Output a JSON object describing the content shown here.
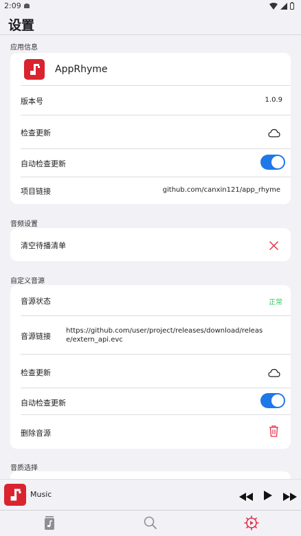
{
  "status_bar": {
    "time": "2:09"
  },
  "header": {
    "title": "设置"
  },
  "sections": {
    "app_info": {
      "title": "应用信息",
      "app_name": "AppRhyme",
      "version_label": "版本号",
      "version_value": "1.0.9",
      "check_update_label": "检查更新",
      "auto_check_label": "自动检查更新",
      "auto_check_on": true,
      "project_link_label": "项目链接",
      "project_link_value": "github.com/canxin121/app_rhyme"
    },
    "audio_settings": {
      "title": "音频设置",
      "clear_queue_label": "清空待播清单"
    },
    "custom_source": {
      "title": "自定义音源",
      "status_label": "音源状态",
      "status_value": "正常",
      "link_label": "音源链接",
      "link_value": "https://github.com/user/project/releases/download/release/extern_api.evc",
      "check_update_label": "检查更新",
      "auto_check_label": "自动检查更新",
      "auto_check_on": true,
      "delete_label": "删除音源"
    },
    "quality": {
      "title": "音质选择"
    }
  },
  "player": {
    "track_title": "Music"
  },
  "colors": {
    "accent": "#1e78e8",
    "brand_red": "#d9232f",
    "success_green": "#34c759",
    "danger_red": "#e5304a",
    "tab_active": "#e5304a"
  },
  "icons": {
    "check_update": "cloud-icon",
    "clear_queue": "close-icon",
    "delete_source": "trash-icon",
    "prev": "rewind-icon",
    "play": "play-icon",
    "next": "fast-forward-icon",
    "tabs": [
      "library-icon",
      "search-icon",
      "settings-icon"
    ]
  }
}
